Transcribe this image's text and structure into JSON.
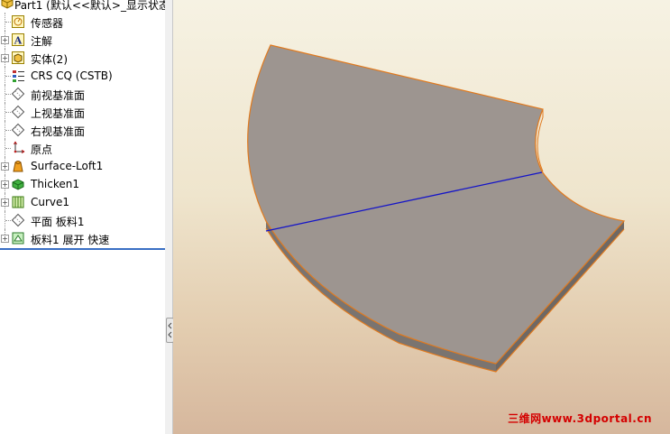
{
  "feature_tree": {
    "root": "Part1  (默认<<默认>_显示状态",
    "items": [
      {
        "label": "传感器",
        "icon": "sensor-icon",
        "expandable": false
      },
      {
        "label": "注解",
        "icon": "annotation-icon",
        "expandable": true
      },
      {
        "label": "实体(2)",
        "icon": "solid-bodies-icon",
        "expandable": true
      },
      {
        "label": "CRS CQ (CSTB)",
        "icon": "material-icon",
        "expandable": false
      },
      {
        "label": "前视基准面",
        "icon": "plane-icon",
        "expandable": false
      },
      {
        "label": "上视基准面",
        "icon": "plane-icon",
        "expandable": false
      },
      {
        "label": "右视基准面",
        "icon": "plane-icon",
        "expandable": false
      },
      {
        "label": "原点",
        "icon": "origin-icon",
        "expandable": false
      },
      {
        "label": "Surface-Loft1",
        "icon": "surface-loft-icon",
        "expandable": true
      },
      {
        "label": "Thicken1",
        "icon": "thicken-icon",
        "expandable": true
      },
      {
        "label": "Curve1",
        "icon": "curve-icon",
        "expandable": true
      },
      {
        "label": "平面 板料1",
        "icon": "plane-icon",
        "expandable": false
      },
      {
        "label": "板料1 展开 快速",
        "icon": "flat-pattern-icon",
        "expandable": true
      }
    ]
  },
  "viewport": {
    "watermark": "三维网www.3dportal.cn",
    "colors": {
      "part_face": "#9d9590",
      "part_edge": "#e07a1f",
      "bend_line": "#1414c8",
      "watermark": "#d40000"
    }
  }
}
